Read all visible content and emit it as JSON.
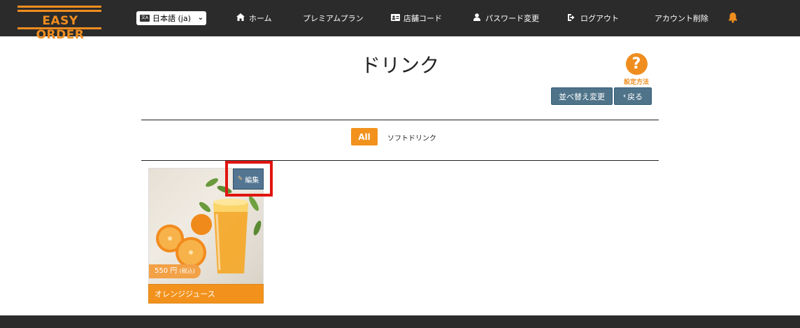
{
  "header": {
    "logo_text": "EASY ORDER",
    "language": "日本語 (ja)",
    "nav": [
      {
        "icon": "home-icon",
        "label": "ホーム"
      },
      {
        "icon": "",
        "label": "プレミアムプラン"
      },
      {
        "icon": "id-card-icon",
        "label": "店舗コード"
      },
      {
        "icon": "user-icon",
        "label": "パスワード変更"
      },
      {
        "icon": "sign-out-icon",
        "label": "ログアウト"
      },
      {
        "icon": "",
        "label": "アカウント削除"
      }
    ],
    "bell_icon": "bell-icon"
  },
  "page": {
    "title": "ドリンク",
    "help_label": "設定方法",
    "sort_button": "並べ替え変更",
    "back_button": "戻る"
  },
  "filters": {
    "all": "All",
    "soft_drink": "ソフトドリンク"
  },
  "items": [
    {
      "name": "オレンジジュース",
      "price": "550 円",
      "tax_note": "(税込)",
      "edit_label": "編集"
    }
  ],
  "colors": {
    "accent": "#f2921d",
    "nav_bg": "#2b2b2b",
    "button_blue": "#4f7389",
    "highlight": "#e0150f"
  }
}
